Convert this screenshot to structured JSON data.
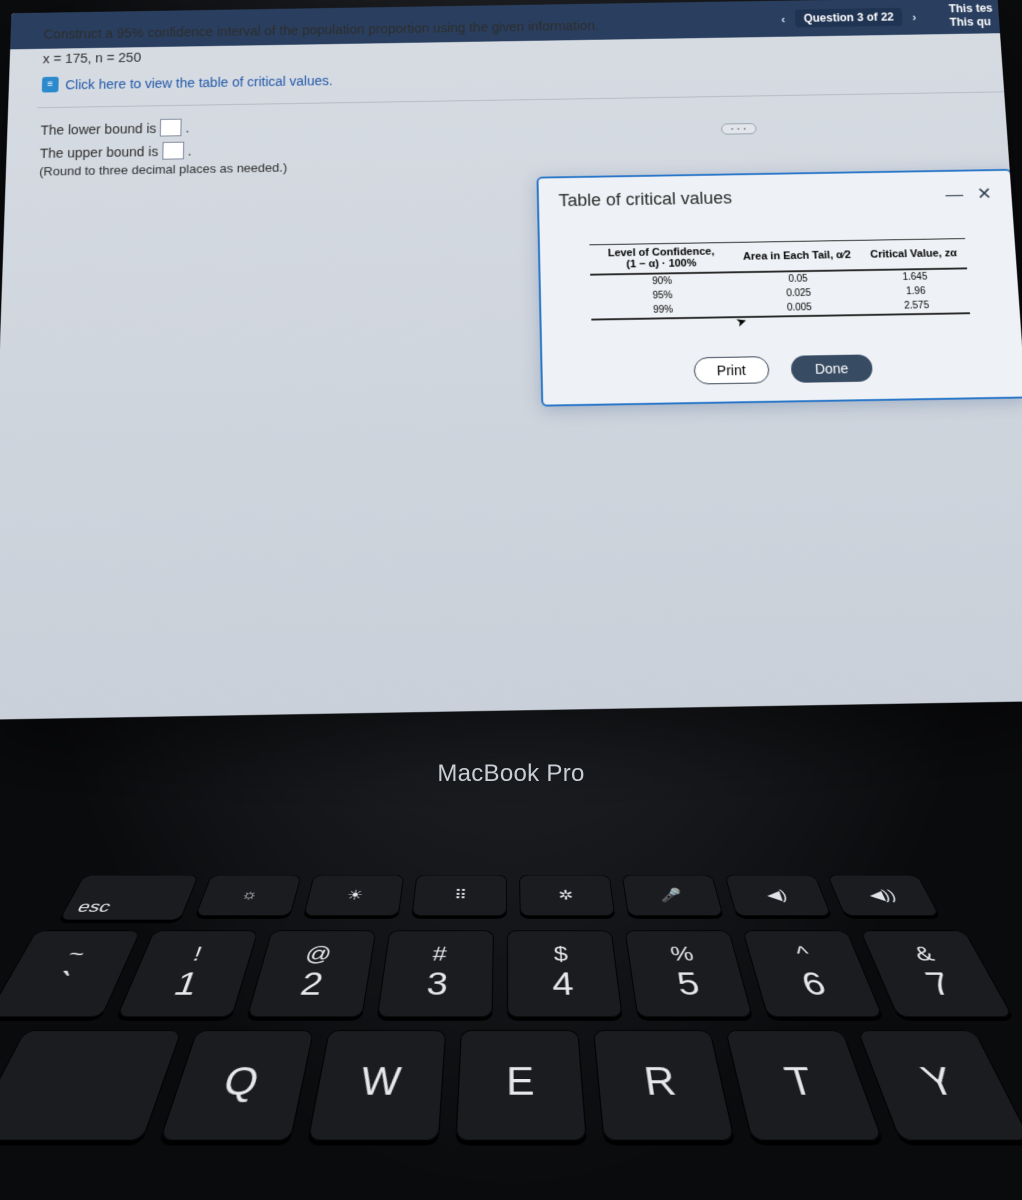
{
  "topbar": {
    "prev_icon": "‹",
    "progress": "Question 3 of 22",
    "next_icon": "›",
    "side_text": "This tes\nThis qu"
  },
  "prompt": {
    "text": "Construct a 95% confidence interval of the population proportion using the given information.",
    "given": "x = 175, n = 250",
    "link_icon": "≡",
    "link_text": "Click here to view the table of critical values."
  },
  "answers": {
    "lower_pre": "The lower bound is ",
    "upper_pre": "The upper bound is ",
    "period": ".",
    "round": "(Round to three decimal places as needed.)"
  },
  "collapse": "• • •",
  "modal": {
    "title": "Table of critical values",
    "minimize": "—",
    "close": "✕",
    "headers": {
      "col1_l1": "Level of Confidence,",
      "col1_l2": "(1 − α) · 100%",
      "col2": "Area in Each Tail, α⁄2",
      "col3": "Critical Value, zα"
    },
    "rows": [
      {
        "conf": "90%",
        "tail": "0.05",
        "z": "1.645"
      },
      {
        "conf": "95%",
        "tail": "0.025",
        "z": "1.96"
      },
      {
        "conf": "99%",
        "tail": "0.005",
        "z": "2.575"
      }
    ],
    "print": "Print",
    "done": "Done"
  },
  "laptop": {
    "label": "MacBook Pro"
  },
  "keys": {
    "esc": "esc",
    "fn": [
      "☼",
      "☀",
      "⠿",
      "✲",
      "🎤",
      "◀︎)",
      "◀︎))"
    ],
    "row1": [
      [
        "!",
        "1"
      ],
      [
        "@",
        "2"
      ],
      [
        "#",
        "3"
      ],
      [
        "$",
        "4"
      ],
      [
        "%",
        "5"
      ],
      [
        "^",
        "6"
      ],
      [
        "&",
        "7"
      ]
    ],
    "tilde_upper": "~",
    "tilde_lower": "`",
    "row2": [
      "Q",
      "W",
      "E",
      "R",
      "T",
      "Y"
    ]
  }
}
